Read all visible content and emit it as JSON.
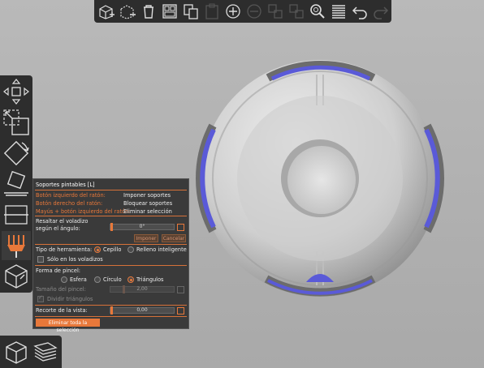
{
  "toolbar": {
    "icons": [
      "add-object-icon",
      "delete-object-icon",
      "delete-all-icon",
      "arrange-icon",
      "copy-icon",
      "paste-icon",
      "add-instance-icon",
      "remove-instance-icon",
      "split-objects-icon",
      "split-parts-icon",
      "search-icon",
      "layers-editing-icon",
      "undo-icon",
      "redo-icon"
    ]
  },
  "left_tools": [
    "move-icon",
    "scale-icon",
    "rotate-icon",
    "place-on-face-icon",
    "cut-icon",
    "paint-supports-icon",
    "seam-painting-icon"
  ],
  "panel": {
    "title": "Soportes pintables [L]",
    "hints": [
      {
        "key": "Botón izquierdo del ratón:",
        "action": "Imponer soportes"
      },
      {
        "key": "Botón derecho del ratón:",
        "action": "Bloquear soportes"
      },
      {
        "key": "Mayús + botón izquierdo del ratón:",
        "action": "Eliminar selección"
      }
    ],
    "overhang_label_1": "Resaltar el voladizo",
    "overhang_label_2": "según el ángulo:",
    "overhang_value": "0°",
    "overhang_fraction": 0.0,
    "enforce_button": "Imponer",
    "cancel_button": "Cancelar",
    "tool_type_label": "Tipo de herramienta:",
    "tool_brush": "Cepillo",
    "tool_smart_fill": "Relleno inteligente",
    "only_overhangs": "Sólo en los voladizos",
    "brush_shape_label": "Forma de pincel:",
    "shape_sphere": "Esfera",
    "shape_circle": "Círculo",
    "shape_triangles": "Triángulos",
    "brush_size_label": "Tamaño del pincel:",
    "brush_size_value": "2,00",
    "brush_size_fraction": 0.2,
    "split_triangles": "Dividir triángulos",
    "clipping_label": "Recorte de la vista:",
    "clipping_value": "0,00",
    "clipping_fraction": 0.0,
    "clear_all_button": "Eliminar toda la selección"
  },
  "view_buttons": [
    "3d-view-icon",
    "preview-layers-icon"
  ],
  "colors": {
    "accent": "#e8783a",
    "panel_bg": "#3a3a3a",
    "support_paint": "#5a5ad8",
    "model": "#d4d4d4"
  }
}
